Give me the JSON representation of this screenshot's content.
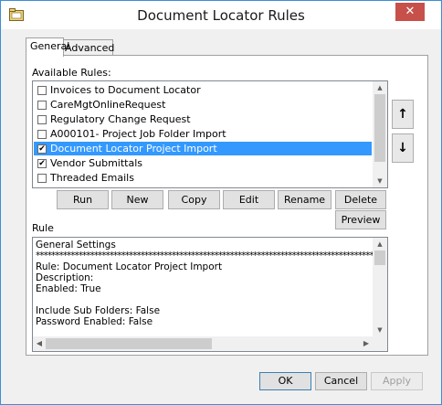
{
  "window": {
    "title": "Document Locator Rules",
    "close_glyph": "✕"
  },
  "tabs": [
    {
      "label": "General"
    },
    {
      "label": "Advanced"
    }
  ],
  "available_rules_label": "Available Rules:",
  "rules": [
    {
      "label": "Invoices to Document Locator",
      "checked": false,
      "selected": false
    },
    {
      "label": "CareMgtOnlineRequest",
      "checked": false,
      "selected": false
    },
    {
      "label": "Regulatory Change Request",
      "checked": false,
      "selected": false
    },
    {
      "label": "A000101- Project Job Folder Import",
      "checked": false,
      "selected": false
    },
    {
      "label": "Document Locator Project Import",
      "checked": true,
      "selected": true
    },
    {
      "label": "Vendor Submittals",
      "checked": true,
      "selected": false
    },
    {
      "label": "Threaded Emails",
      "checked": false,
      "selected": false
    }
  ],
  "side_buttons": {
    "move_up": "↑",
    "move_down": "↓"
  },
  "rule_buttons": {
    "run": "Run",
    "new": "New",
    "copy": "Copy",
    "edit": "Edit",
    "rename": "Rename",
    "delete": "Delete",
    "preview": "Preview"
  },
  "rule_label": "Rule",
  "rule_text": [
    "General Settings",
    "************************************************************************************************",
    "Rule: Document Locator Project Import",
    "Description:",
    "Enabled: True",
    "",
    "Include Sub Folders: False",
    "Password Enabled: False"
  ],
  "footer": {
    "ok": "OK",
    "cancel": "Cancel",
    "apply": "Apply"
  },
  "colors": {
    "selection": "#3399ff",
    "close": "#c7504a",
    "border": "#3b8ed6"
  }
}
